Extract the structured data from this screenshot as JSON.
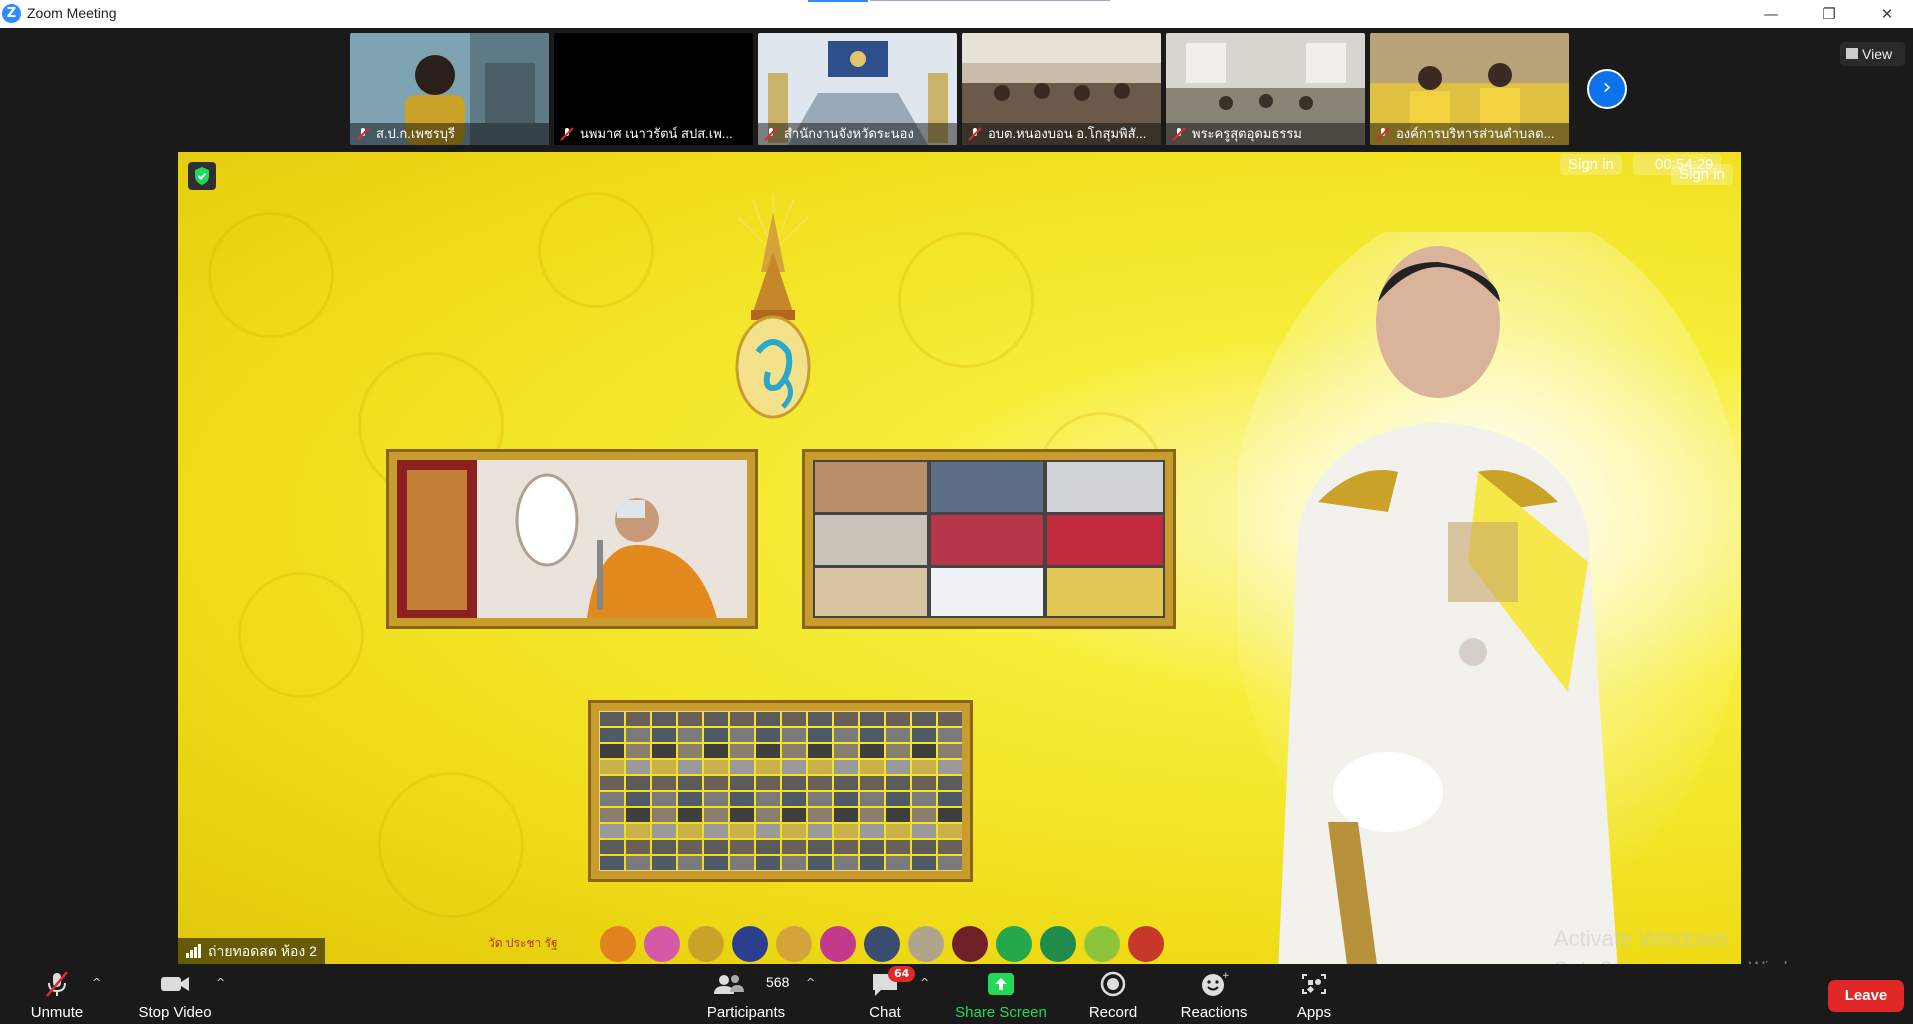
{
  "window": {
    "title": "Zoom Meeting",
    "logo_letter": "Z"
  },
  "thumbnails": [
    {
      "name": "ส.ป.ก.เพชรบุรี",
      "bg": "#6f8fa0"
    },
    {
      "name": "นพมาศ เนาวรัตน์ สปส.เพ...",
      "bg": "#000000"
    },
    {
      "name": "สำนักงานจังหวัดระนอง",
      "bg": "#b9c6d4"
    },
    {
      "name": "อบต.หนองบอน อ.โกสุมพิสั...",
      "bg": "#9a8f86"
    },
    {
      "name": "พระครูสุตอุดมธรรม",
      "bg": "#a19a8e"
    },
    {
      "name": "องค์การบริหารส่วนตำบลต...",
      "bg": "#b89a52"
    }
  ],
  "view_button": "View",
  "stage": {
    "sign_in_1": "Sign in",
    "timer": "00:54:29",
    "sign_in_2": "Sign in",
    "speaker_label": "ถ่ายทอดสด ห้อง 2",
    "emblem_caption": "วัด ประชา รัฐ"
  },
  "watermark": {
    "line1": "Activate Windows",
    "line2": "Go to Settings to activate Windows."
  },
  "toolbar": {
    "unmute": "Unmute",
    "stop_video": "Stop Video",
    "participants": "Participants",
    "participant_count": "568",
    "chat": "Chat",
    "chat_badge": "64",
    "share_screen": "Share Screen",
    "record": "Record",
    "reactions": "Reactions",
    "apps": "Apps",
    "leave": "Leave"
  },
  "colors": {
    "accent": "#0e72ed",
    "share_green": "#23d959",
    "leave_red": "#e02828",
    "stage_yellow": "#efdc17"
  }
}
